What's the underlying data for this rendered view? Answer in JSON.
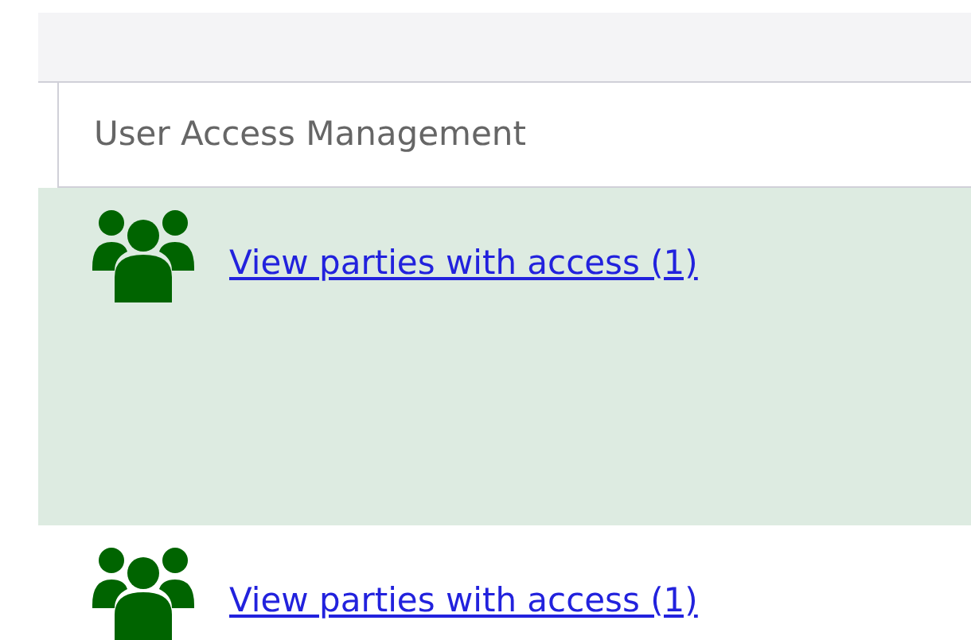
{
  "table": {
    "column_header": "User Access Management",
    "rows": [
      {
        "link": "View parties with access (1)",
        "selected": true
      },
      {
        "link": "View parties with access (1)",
        "selected": false
      }
    ]
  }
}
